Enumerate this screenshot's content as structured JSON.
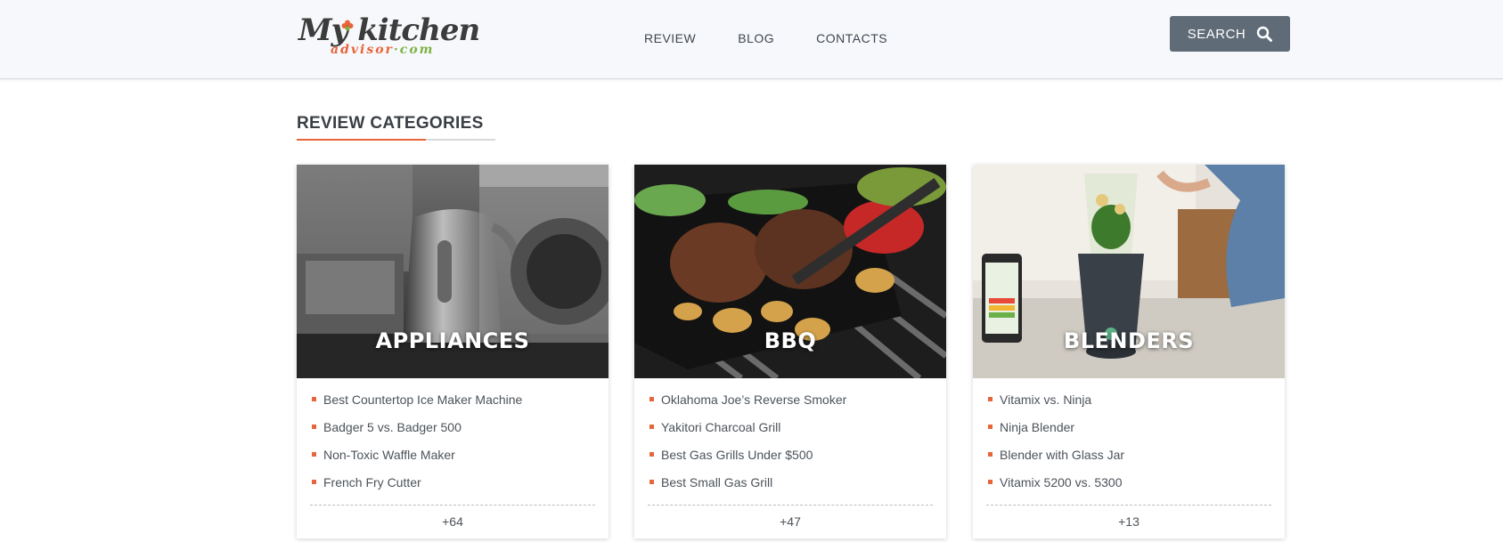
{
  "header": {
    "logo": {
      "main": "My kitchen",
      "sub_left": "advisor",
      "sub_right": "·com"
    },
    "nav": [
      {
        "label": "REVIEW"
      },
      {
        "label": "BLOG"
      },
      {
        "label": "CONTACTS"
      }
    ],
    "search_label": "SEARCH",
    "search_icon": "magnifier-icon"
  },
  "colors": {
    "accent": "#e8643a",
    "logo_green": "#7cb342",
    "search_button": "#5f6b76",
    "header_bg": "#f7f8fb"
  },
  "section": {
    "title": "REVIEW CATEGORIES"
  },
  "cards": [
    {
      "category": "APPLIANCES",
      "items": [
        "Best Countertop Ice Maker Machine",
        "Badger 5 vs. Badger 500",
        "Non-Toxic Waffle Maker",
        "French Fry Cutter"
      ],
      "more": "+64"
    },
    {
      "category": "BBQ",
      "items": [
        "Oklahoma Joe’s Reverse Smoker",
        "Yakitori Charcoal Grill",
        "Best Gas Grills Under $500",
        "Best Small Gas Grill"
      ],
      "more": "+47"
    },
    {
      "category": "BLENDERS",
      "items": [
        "Vitamix vs. Ninja",
        "Ninja Blender",
        "Blender with Glass Jar",
        "Vitamix 5200 vs. 5300"
      ],
      "more": "+13"
    }
  ]
}
